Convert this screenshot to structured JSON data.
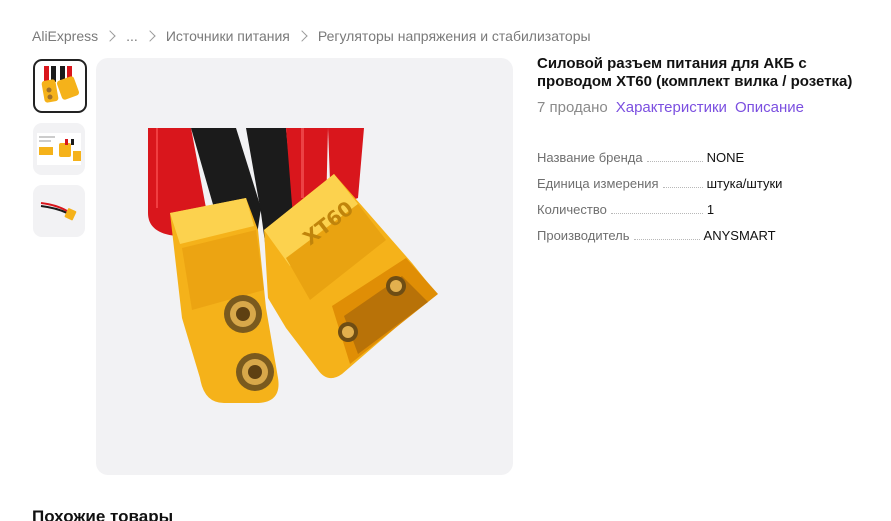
{
  "breadcrumb": {
    "items": [
      "AliExpress",
      "...",
      "Источники питания",
      "Регуляторы напряжения и стабилизаторы"
    ]
  },
  "product": {
    "title": "Силовой разъем питания для АКБ с проводом XT60 (комплект вилка / розетка)",
    "sold": "7 продано",
    "characteristics_link": "Характеристики",
    "description_link": "Описание"
  },
  "specs": [
    {
      "key": "Название бренда",
      "value": "NONE"
    },
    {
      "key": "Единица измерения",
      "value": "штука/штуки"
    },
    {
      "key": "Количество",
      "value": "1"
    },
    {
      "key": "Производитель",
      "value": "ANYSMART"
    }
  ],
  "similar": {
    "heading": "Похожие товары"
  },
  "colors": {
    "link": "#7b4fe0",
    "connector": "#f5b21a",
    "wire_red": "#d9161c",
    "wire_black": "#1b1b1b"
  }
}
